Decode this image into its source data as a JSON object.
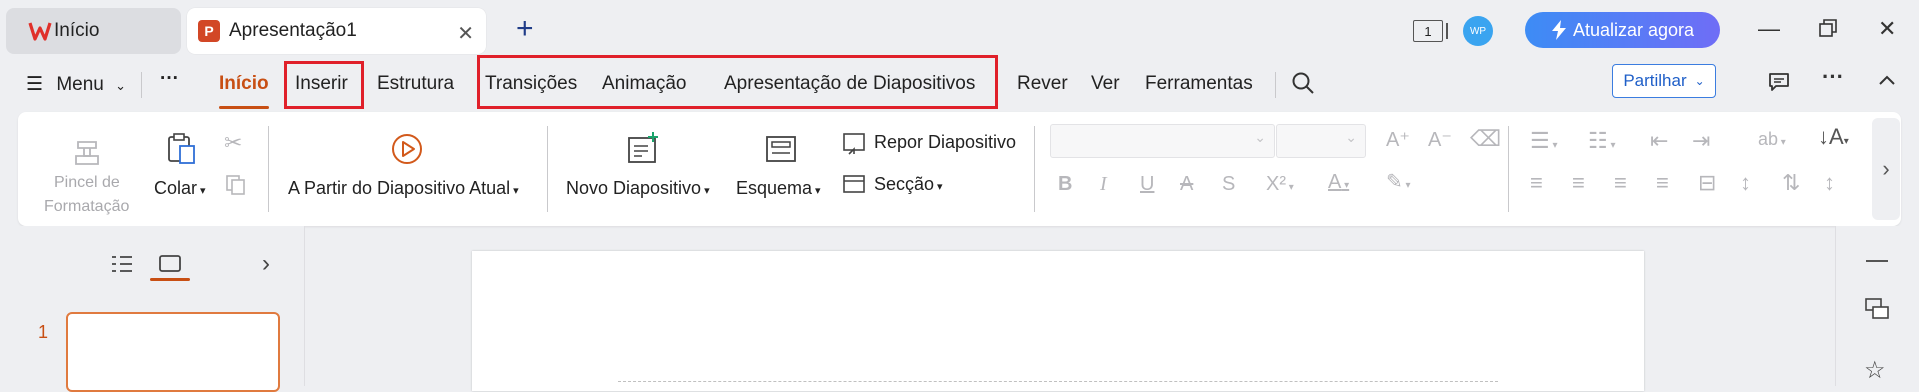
{
  "titlebar": {
    "home_tab_label": "Início",
    "doc_tab_label": "Apresentação1",
    "doc_tab_icon_letter": "P",
    "window_count": "1",
    "avatar_text": "WP",
    "upgrade_label": "Atualizar agora"
  },
  "menu": {
    "menu_label": "Menu",
    "more_label": "···",
    "tabs": [
      {
        "label": "Início"
      },
      {
        "label": "Inserir"
      },
      {
        "label": "Estrutura"
      },
      {
        "label": "Transições"
      },
      {
        "label": "Animação"
      },
      {
        "label": "Apresentação de Diapositivos"
      },
      {
        "label": "Rever"
      },
      {
        "label": "Ver"
      },
      {
        "label": "Ferramentas"
      }
    ],
    "share_label": "Partilhar"
  },
  "ribbon": {
    "format_painter_line1": "Pincel de",
    "format_painter_line2": "Formatação",
    "paste_label": "Colar",
    "from_current_label": "A Partir do Diapositivo Atual",
    "new_slide_label": "Novo Diapositivo",
    "layout_label": "Esquema",
    "reset_slide_label": "Repor Diapositivo",
    "section_label": "Secção"
  },
  "slides_panel": {
    "slide_number": "1"
  },
  "colors": {
    "accent": "#c84f14",
    "highlight_box": "#e0202a",
    "upgrade_start": "#3d8cf5",
    "upgrade_end": "#6f6df6"
  }
}
